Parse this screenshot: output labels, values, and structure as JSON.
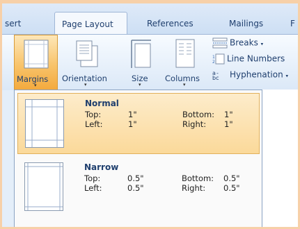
{
  "tabs": {
    "insert_partial": "sert",
    "page_layout": "Page Layout",
    "references": "References",
    "mailings": "Mailings",
    "review_partial": "F"
  },
  "ribbon": {
    "margins": "Margins",
    "orientation": "Orientation",
    "size": "Size",
    "columns": "Columns",
    "breaks": "Breaks",
    "line_numbers": "Line Numbers",
    "hyphenation": "Hyphenation",
    "dropdown_arrow": "▾"
  },
  "margin_options": [
    {
      "title": "Normal",
      "top_label": "Top:",
      "top_value": "1\"",
      "left_label": "Left:",
      "left_value": "1\"",
      "bottom_label": "Bottom:",
      "bottom_value": "1\"",
      "right_label": "Right:",
      "right_value": "1\""
    },
    {
      "title": "Narrow",
      "top_label": "Top:",
      "top_value": "0.5\"",
      "left_label": "Left:",
      "left_value": "0.5\"",
      "bottom_label": "Bottom:",
      "bottom_value": "0.5\"",
      "right_label": "Right:",
      "right_value": "0.5\""
    }
  ],
  "colors": {
    "frame_border": "#f7d0a8",
    "highlight": "#fbd99a",
    "text": "#1f3f6e"
  }
}
